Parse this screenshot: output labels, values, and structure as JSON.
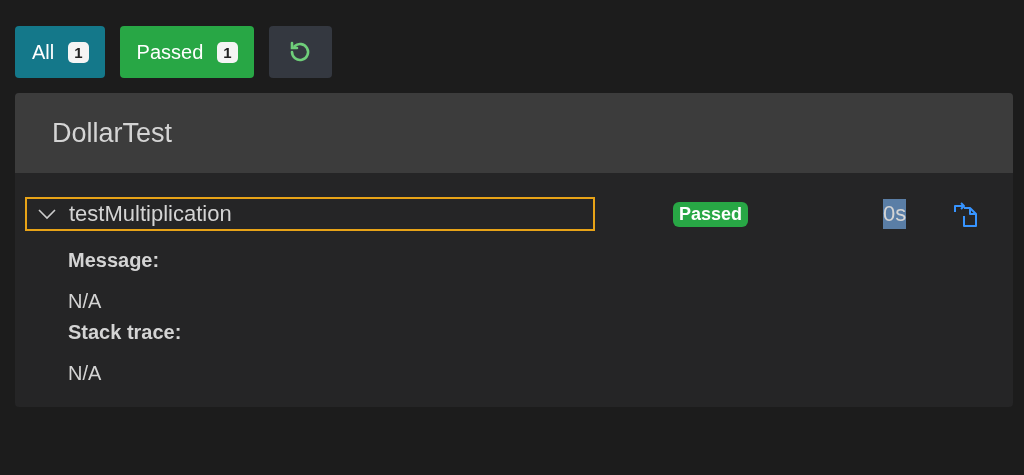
{
  "filters": [
    {
      "label": "All",
      "count": "1",
      "color": "#14788a"
    },
    {
      "label": "Passed",
      "count": "1",
      "color": "#28a745"
    }
  ],
  "suite": {
    "title": "DollarTest",
    "tests": [
      {
        "name": "testMultiplication",
        "expanded": true,
        "focused": true,
        "status": "Passed",
        "kind": "passed",
        "duration": "0s",
        "duration_highlighted": true,
        "details": [
          {
            "label": "Message:",
            "value": "N/A"
          },
          {
            "label": "Stack trace:",
            "value": "N/A"
          }
        ]
      }
    ]
  }
}
